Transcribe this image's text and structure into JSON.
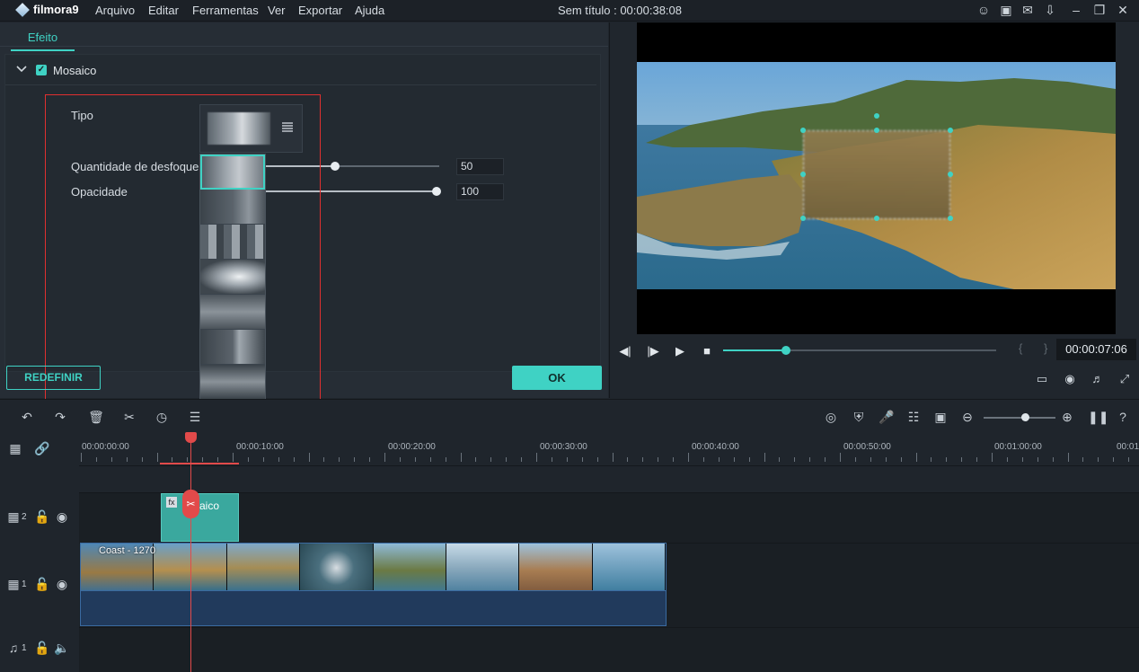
{
  "app": {
    "logo_text": "filmora9",
    "window_title": "Sem título : 00:00:38:08"
  },
  "menu": [
    "Arquivo",
    "Editar",
    "Ferramentas",
    "Ver",
    "Exportar",
    "Ajuda"
  ],
  "window_icons": [
    "user-icon",
    "save-icon",
    "mail-icon",
    "download-icon",
    "minimize-icon",
    "restore-icon",
    "close-icon"
  ],
  "effect_panel": {
    "tab": "Efeito",
    "effect_name": "Mosaico",
    "effect_enabled": true,
    "props": {
      "type_label": "Tipo",
      "blur_label": "Quantidade de desfoque",
      "blur_value": "50",
      "opacity_label": "Opacidade",
      "opacity_value": "100"
    },
    "reset_label": "REDEFINIR",
    "ok_label": "OK"
  },
  "preview": {
    "timecode": "00:00:07:06",
    "progress": 0.23,
    "brackets": "{ }"
  },
  "timeline": {
    "ruler": [
      "00:00:00:00",
      "00:00:10:00",
      "00:00:20:00",
      "00:00:30:00",
      "00:00:40:00",
      "00:00:50:00",
      "00:01:00:00",
      "00:01"
    ],
    "track2_label": "2",
    "track1_label": "1",
    "audio_label": "1",
    "fx_clip_label": "saico",
    "video_clip_label": "Coast - 1270"
  },
  "colors": {
    "accent": "#3fd2c4",
    "playhead": "#e24a4a"
  }
}
